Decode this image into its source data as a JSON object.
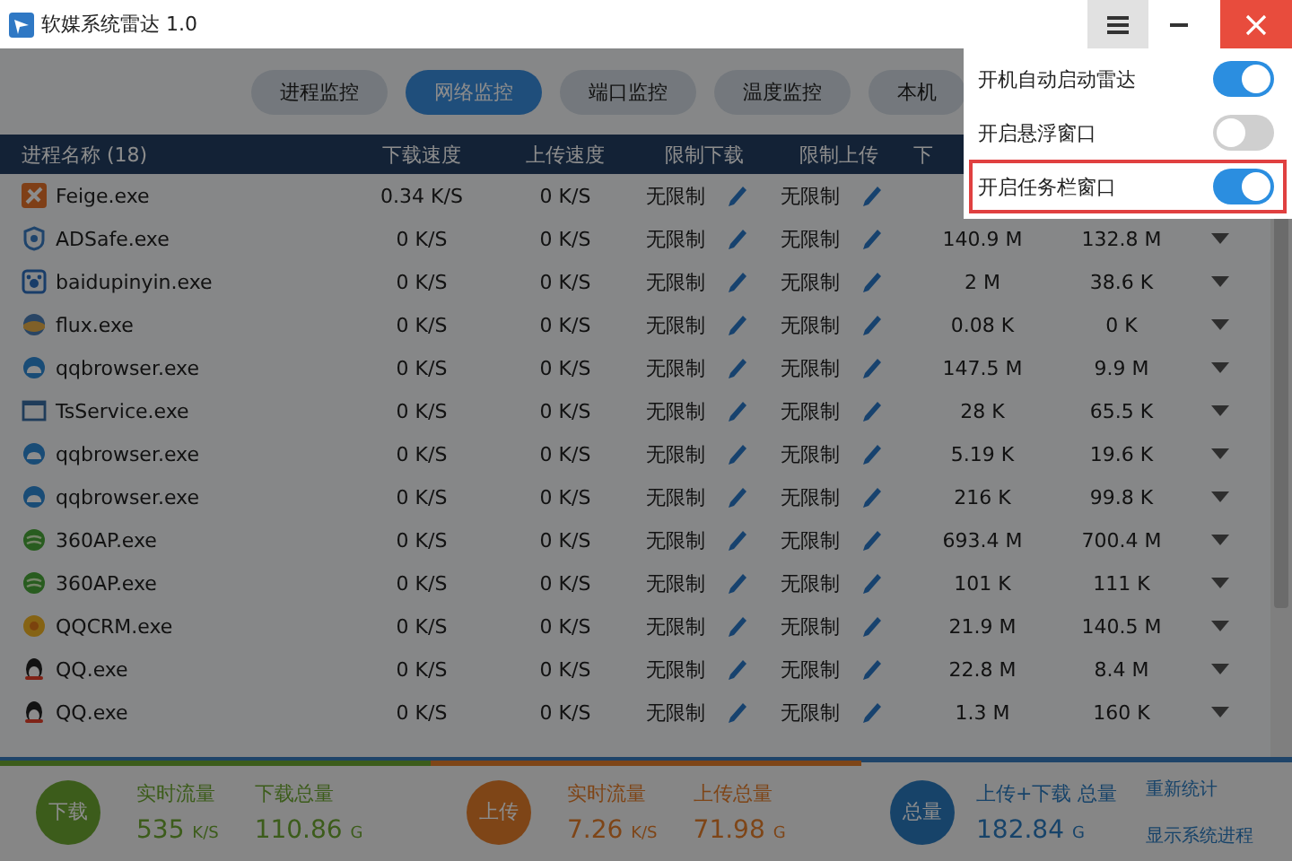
{
  "window": {
    "title": "软媒系统雷达 1.0"
  },
  "menu_button": {
    "expanded": true
  },
  "tabs": [
    {
      "label": "进程监控",
      "selected": false
    },
    {
      "label": "网络监控",
      "selected": true
    },
    {
      "label": "端口监控",
      "selected": false
    },
    {
      "label": "温度监控",
      "selected": false
    },
    {
      "label": "本机",
      "selected": false
    }
  ],
  "table": {
    "columns": [
      "进程名称 (18)",
      "下载速度",
      "上传速度",
      "限制下载",
      "限制上传",
      "下"
    ],
    "rows": [
      {
        "kind": "tile",
        "name": "Feige.exe",
        "download_speed": "0.34 K/S",
        "upload_speed": "0 K/S",
        "limit_download": "无限制",
        "limit_upload": "无限制"
      },
      {
        "kind": "shield",
        "name": "ADSafe.exe",
        "download_speed": "0 K/S",
        "upload_speed": "0 K/S",
        "limit_download": "无限制",
        "limit_upload": "无限制",
        "column_6": "140.9 M",
        "column_7": "132.8 M"
      },
      {
        "kind": "paw",
        "name": "baidupinyin.exe",
        "download_speed": "0 K/S",
        "upload_speed": "0 K/S",
        "limit_download": "无限制",
        "limit_upload": "无限制",
        "column_6": "2 M",
        "column_7": "38.6 K"
      },
      {
        "kind": "globe",
        "name": "flux.exe",
        "download_speed": "0 K/S",
        "upload_speed": "0 K/S",
        "limit_download": "无限制",
        "limit_upload": "无限制",
        "column_6": "0.08 K",
        "column_7": "0 K"
      },
      {
        "kind": "cloud",
        "name": "qqbrowser.exe",
        "download_speed": "0 K/S",
        "upload_speed": "0 K/S",
        "limit_download": "无限制",
        "limit_upload": "无限制",
        "column_6": "147.5 M",
        "column_7": "9.9 M"
      },
      {
        "kind": "window",
        "name": "TsService.exe",
        "download_speed": "0 K/S",
        "upload_speed": "0 K/S",
        "limit_download": "无限制",
        "limit_upload": "无限制",
        "column_6": "28 K",
        "column_7": "65.5 K"
      },
      {
        "kind": "cloud",
        "name": "qqbrowser.exe",
        "download_speed": "0 K/S",
        "upload_speed": "0 K/S",
        "limit_download": "无限制",
        "limit_upload": "无限制",
        "column_6": "5.19 K",
        "column_7": "19.6 K"
      },
      {
        "kind": "cloud",
        "name": "qqbrowser.exe",
        "download_speed": "0 K/S",
        "upload_speed": "0 K/S",
        "limit_download": "无限制",
        "limit_upload": "无限制",
        "column_6": "216 K",
        "column_7": "99.8 K"
      },
      {
        "kind": "leaf",
        "name": "360AP.exe",
        "download_speed": "0 K/S",
        "upload_speed": "0 K/S",
        "limit_download": "无限制",
        "limit_upload": "无限制",
        "column_6": "693.4 M",
        "column_7": "700.4 M"
      },
      {
        "kind": "leaf",
        "name": "360AP.exe",
        "download_speed": "0 K/S",
        "upload_speed": "0 K/S",
        "limit_download": "无限制",
        "limit_upload": "无限制",
        "column_6": "101 K",
        "column_7": "111 K"
      },
      {
        "kind": "flower",
        "name": "QQCRM.exe",
        "download_speed": "0 K/S",
        "upload_speed": "0 K/S",
        "limit_download": "无限制",
        "limit_upload": "无限制",
        "column_6": "21.9 M",
        "column_7": "140.5 M"
      },
      {
        "kind": "penguin",
        "name": "QQ.exe",
        "download_speed": "0 K/S",
        "upload_speed": "0 K/S",
        "limit_download": "无限制",
        "limit_upload": "无限制",
        "column_6": "22.8 M",
        "column_7": "8.4 M"
      },
      {
        "kind": "penguin",
        "name": "QQ.exe",
        "download_speed": "0 K/S",
        "upload_speed": "0 K/S",
        "limit_download": "无限制",
        "limit_upload": "无限制",
        "column_6": "1.3 M",
        "column_7": "160 K"
      }
    ]
  },
  "stats": [
    {
      "kind": "download",
      "badge": "下载",
      "live_label": "实时流量",
      "live_value": "535",
      "live_unit": "K/S",
      "total_label": "下载总量",
      "total_value": "110.86",
      "total_unit": "G"
    },
    {
      "kind": "upload",
      "badge": "上传",
      "live_label": "实时流量",
      "live_value": "7.26",
      "live_unit": "K/S",
      "total_label": "上传总量",
      "total_value": "71.98",
      "total_unit": "G"
    },
    {
      "kind": "total",
      "badge": "总量",
      "total_label": "上传+下载 总量",
      "total_value": "182.84",
      "total_unit": "G"
    }
  ],
  "links": [
    "重新统计",
    "显示系统进程"
  ],
  "menu": [
    {
      "label": "开机自动启动雷达",
      "on": true,
      "highlighted": false
    },
    {
      "label": "开启悬浮窗口",
      "on": false,
      "highlighted": false
    },
    {
      "label": "开启任务栏窗口",
      "on": true,
      "highlighted": true
    }
  ]
}
